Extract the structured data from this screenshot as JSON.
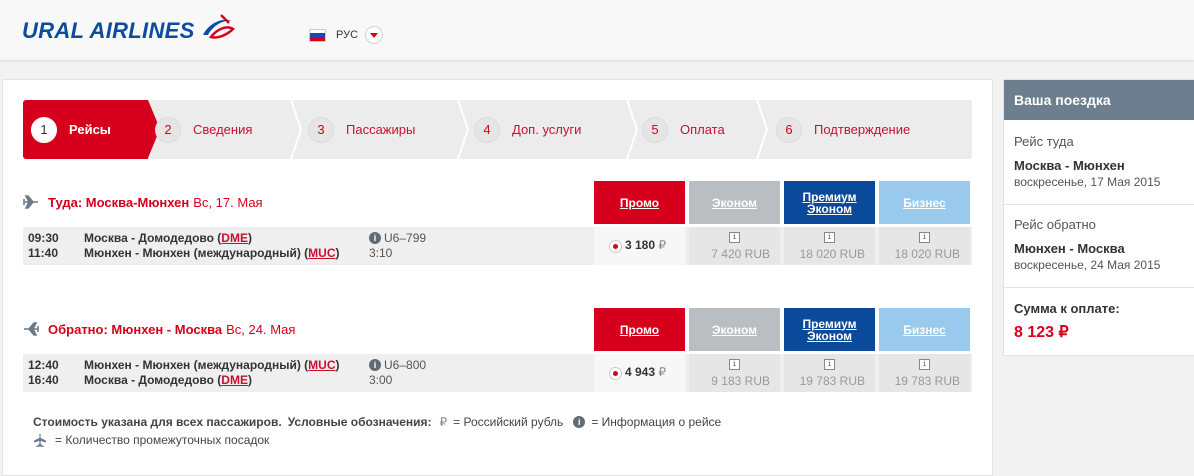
{
  "header": {
    "logo_text": "URAL AIRLINES",
    "language": "РУС",
    "flag_colors": [
      "#ffffff",
      "#1c47b5",
      "#d6001c"
    ]
  },
  "steps": [
    {
      "num": "1",
      "label": "Рейсы",
      "active": true
    },
    {
      "num": "2",
      "label": "Сведения",
      "active": false
    },
    {
      "num": "3",
      "label": "Пассажиры",
      "active": false
    },
    {
      "num": "4",
      "label": "Доп. услуги",
      "active": false
    },
    {
      "num": "5",
      "label": "Оплата",
      "active": false
    },
    {
      "num": "6",
      "label": "Подтверждение",
      "active": false
    }
  ],
  "fare_classes": {
    "promo": "Промо",
    "econom": "Эконом",
    "premium": "Премиум Эконом",
    "business": "Бизнес"
  },
  "outbound": {
    "direction": "Туда: Москва-Мюнхен",
    "date": "Вс, 17. Мая",
    "dep_time": "09:30",
    "arr_time": "11:40",
    "dep_airport": "Москва - Домодедово",
    "dep_code": "DME",
    "arr_airport": "Мюнхен - Мюнхен (международный)",
    "arr_code": "MUC",
    "flight_no": "U6–799",
    "duration": "3:10",
    "promo_price": "3 180",
    "econom_price": "7 420 RUB",
    "premium_price": "18 020 RUB",
    "business_price": "18 020 RUB"
  },
  "inbound": {
    "direction": "Обратно: Мюнхен - Москва",
    "date": "Вс, 24. Мая",
    "dep_time": "12:40",
    "arr_time": "16:40",
    "dep_airport": "Мюнхен - Мюнхен (международный)",
    "dep_code": "MUC",
    "arr_airport": "Москва - Домодедово",
    "arr_code": "DME",
    "flight_no": "U6–800",
    "duration": "3:00",
    "promo_price": "4 943",
    "econom_price": "9 183 RUB",
    "premium_price": "19 783 RUB",
    "business_price": "19 783 RUB"
  },
  "currency_symbol": "₽",
  "legend": {
    "price_note": "Стоимость указана для всех пассажиров.",
    "legend_title": "Условные обозначения:",
    "rub": "= Российский рубль",
    "info": "= Информация о рейсе",
    "stops": "= Количество промежуточных посадок"
  },
  "summary": {
    "title": "Ваша поездка",
    "out_caption": "Рейс туда",
    "out_route": "Москва - Мюнхен",
    "out_date": "воскресенье, 17 Мая 2015",
    "in_caption": "Рейс обратно",
    "in_route": "Мюнхен - Москва",
    "in_date": "воскресенье, 24 Мая 2015",
    "total_caption": "Сумма к оплате:",
    "total": "8 123 ₽"
  },
  "colors": {
    "brand_red": "#d6001c",
    "brand_blue": "#0d4b9e",
    "econom_gray": "#b9bec3",
    "premium_blue": "#0b4a9a",
    "business_light": "#99c9ec"
  }
}
